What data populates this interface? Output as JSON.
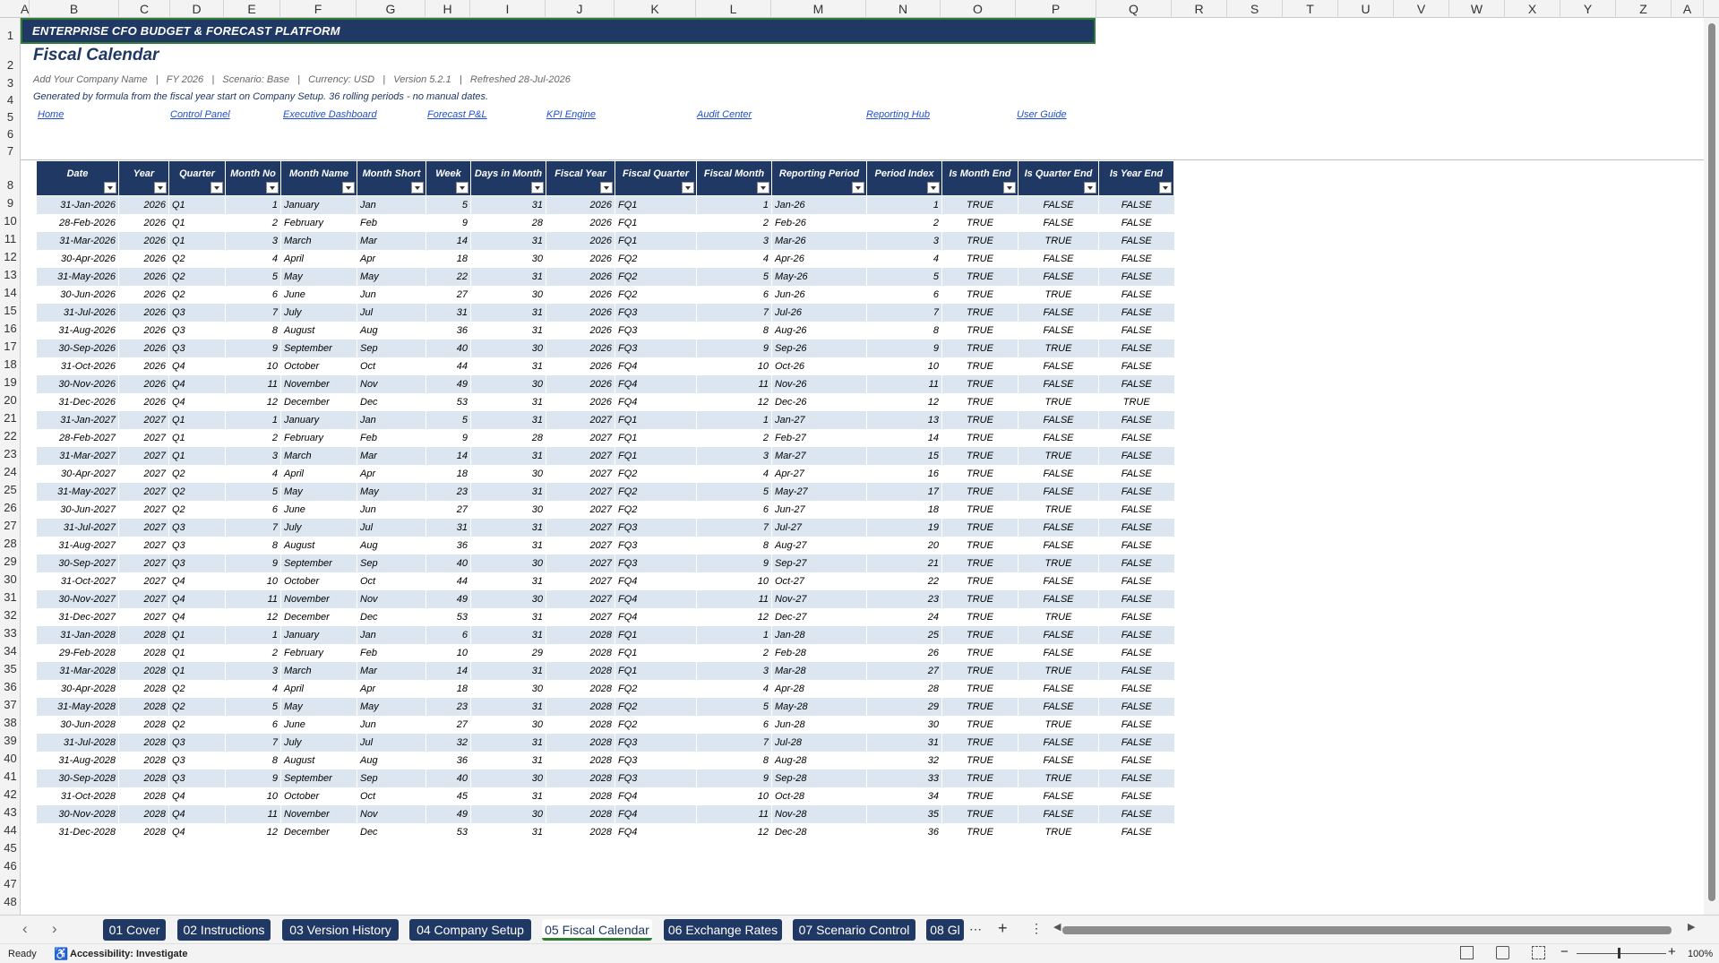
{
  "columns": [
    "A",
    "B",
    "C",
    "D",
    "E",
    "F",
    "G",
    "H",
    "I",
    "J",
    "K",
    "L",
    "M",
    "N",
    "O",
    "P",
    "Q",
    "R",
    "S",
    "T",
    "U",
    "V",
    "W",
    "X",
    "Y",
    "Z",
    "A"
  ],
  "rows": [
    "1",
    "2",
    "3",
    "4",
    "5",
    "6",
    "7",
    "8",
    "9",
    "10",
    "11",
    "12",
    "13",
    "14",
    "15",
    "16",
    "17",
    "18",
    "19",
    "20",
    "21",
    "22",
    "23",
    "24",
    "25",
    "26",
    "27",
    "28",
    "29",
    "30",
    "31",
    "32",
    "33",
    "34",
    "35",
    "36",
    "37",
    "38",
    "39",
    "40",
    "41",
    "42",
    "43",
    "44",
    "45",
    "46",
    "47",
    "48"
  ],
  "banner": "ENTERPRISE CFO BUDGET & FORECAST PLATFORM",
  "title": "Fiscal Calendar",
  "meta": "Add Your Company Name   |   FY 2026   |   Scenario: Base   |   Currency: USD   |   Version 5.2.1   |   Refreshed 28-Jul-2026",
  "note": "Generated by formula from the fiscal year start on Company Setup. 36 rolling periods - no manual dates.",
  "links": [
    "Home",
    "Control Panel",
    "Executive Dashboard",
    "Forecast P&L",
    "KPI Engine",
    "Audit Center",
    "Reporting Hub",
    "User Guide"
  ],
  "table": {
    "headers": [
      "Date",
      "Year",
      "Quarter",
      "Month No",
      "Month Name",
      "Month Short",
      "Week",
      "Days in Month",
      "Fiscal Year",
      "Fiscal Quarter",
      "Fiscal Month",
      "Reporting Period",
      "Period Index",
      "Is Month End",
      "Is Quarter End",
      "Is Year End"
    ],
    "rows": [
      [
        "31-Jan-2026",
        "2026",
        "Q1",
        "1",
        "January",
        "Jan",
        "5",
        "31",
        "2026",
        "FQ1",
        "1",
        "Jan-26",
        "1",
        "TRUE",
        "FALSE",
        "FALSE"
      ],
      [
        "28-Feb-2026",
        "2026",
        "Q1",
        "2",
        "February",
        "Feb",
        "9",
        "28",
        "2026",
        "FQ1",
        "2",
        "Feb-26",
        "2",
        "TRUE",
        "FALSE",
        "FALSE"
      ],
      [
        "31-Mar-2026",
        "2026",
        "Q1",
        "3",
        "March",
        "Mar",
        "14",
        "31",
        "2026",
        "FQ1",
        "3",
        "Mar-26",
        "3",
        "TRUE",
        "TRUE",
        "FALSE"
      ],
      [
        "30-Apr-2026",
        "2026",
        "Q2",
        "4",
        "April",
        "Apr",
        "18",
        "30",
        "2026",
        "FQ2",
        "4",
        "Apr-26",
        "4",
        "TRUE",
        "FALSE",
        "FALSE"
      ],
      [
        "31-May-2026",
        "2026",
        "Q2",
        "5",
        "May",
        "May",
        "22",
        "31",
        "2026",
        "FQ2",
        "5",
        "May-26",
        "5",
        "TRUE",
        "FALSE",
        "FALSE"
      ],
      [
        "30-Jun-2026",
        "2026",
        "Q2",
        "6",
        "June",
        "Jun",
        "27",
        "30",
        "2026",
        "FQ2",
        "6",
        "Jun-26",
        "6",
        "TRUE",
        "TRUE",
        "FALSE"
      ],
      [
        "31-Jul-2026",
        "2026",
        "Q3",
        "7",
        "July",
        "Jul",
        "31",
        "31",
        "2026",
        "FQ3",
        "7",
        "Jul-26",
        "7",
        "TRUE",
        "FALSE",
        "FALSE"
      ],
      [
        "31-Aug-2026",
        "2026",
        "Q3",
        "8",
        "August",
        "Aug",
        "36",
        "31",
        "2026",
        "FQ3",
        "8",
        "Aug-26",
        "8",
        "TRUE",
        "FALSE",
        "FALSE"
      ],
      [
        "30-Sep-2026",
        "2026",
        "Q3",
        "9",
        "September",
        "Sep",
        "40",
        "30",
        "2026",
        "FQ3",
        "9",
        "Sep-26",
        "9",
        "TRUE",
        "TRUE",
        "FALSE"
      ],
      [
        "31-Oct-2026",
        "2026",
        "Q4",
        "10",
        "October",
        "Oct",
        "44",
        "31",
        "2026",
        "FQ4",
        "10",
        "Oct-26",
        "10",
        "TRUE",
        "FALSE",
        "FALSE"
      ],
      [
        "30-Nov-2026",
        "2026",
        "Q4",
        "11",
        "November",
        "Nov",
        "49",
        "30",
        "2026",
        "FQ4",
        "11",
        "Nov-26",
        "11",
        "TRUE",
        "FALSE",
        "FALSE"
      ],
      [
        "31-Dec-2026",
        "2026",
        "Q4",
        "12",
        "December",
        "Dec",
        "53",
        "31",
        "2026",
        "FQ4",
        "12",
        "Dec-26",
        "12",
        "TRUE",
        "TRUE",
        "TRUE"
      ],
      [
        "31-Jan-2027",
        "2027",
        "Q1",
        "1",
        "January",
        "Jan",
        "5",
        "31",
        "2027",
        "FQ1",
        "1",
        "Jan-27",
        "13",
        "TRUE",
        "FALSE",
        "FALSE"
      ],
      [
        "28-Feb-2027",
        "2027",
        "Q1",
        "2",
        "February",
        "Feb",
        "9",
        "28",
        "2027",
        "FQ1",
        "2",
        "Feb-27",
        "14",
        "TRUE",
        "FALSE",
        "FALSE"
      ],
      [
        "31-Mar-2027",
        "2027",
        "Q1",
        "3",
        "March",
        "Mar",
        "14",
        "31",
        "2027",
        "FQ1",
        "3",
        "Mar-27",
        "15",
        "TRUE",
        "TRUE",
        "FALSE"
      ],
      [
        "30-Apr-2027",
        "2027",
        "Q2",
        "4",
        "April",
        "Apr",
        "18",
        "30",
        "2027",
        "FQ2",
        "4",
        "Apr-27",
        "16",
        "TRUE",
        "FALSE",
        "FALSE"
      ],
      [
        "31-May-2027",
        "2027",
        "Q2",
        "5",
        "May",
        "May",
        "23",
        "31",
        "2027",
        "FQ2",
        "5",
        "May-27",
        "17",
        "TRUE",
        "FALSE",
        "FALSE"
      ],
      [
        "30-Jun-2027",
        "2027",
        "Q2",
        "6",
        "June",
        "Jun",
        "27",
        "30",
        "2027",
        "FQ2",
        "6",
        "Jun-27",
        "18",
        "TRUE",
        "TRUE",
        "FALSE"
      ],
      [
        "31-Jul-2027",
        "2027",
        "Q3",
        "7",
        "July",
        "Jul",
        "31",
        "31",
        "2027",
        "FQ3",
        "7",
        "Jul-27",
        "19",
        "TRUE",
        "FALSE",
        "FALSE"
      ],
      [
        "31-Aug-2027",
        "2027",
        "Q3",
        "8",
        "August",
        "Aug",
        "36",
        "31",
        "2027",
        "FQ3",
        "8",
        "Aug-27",
        "20",
        "TRUE",
        "FALSE",
        "FALSE"
      ],
      [
        "30-Sep-2027",
        "2027",
        "Q3",
        "9",
        "September",
        "Sep",
        "40",
        "30",
        "2027",
        "FQ3",
        "9",
        "Sep-27",
        "21",
        "TRUE",
        "TRUE",
        "FALSE"
      ],
      [
        "31-Oct-2027",
        "2027",
        "Q4",
        "10",
        "October",
        "Oct",
        "44",
        "31",
        "2027",
        "FQ4",
        "10",
        "Oct-27",
        "22",
        "TRUE",
        "FALSE",
        "FALSE"
      ],
      [
        "30-Nov-2027",
        "2027",
        "Q4",
        "11",
        "November",
        "Nov",
        "49",
        "30",
        "2027",
        "FQ4",
        "11",
        "Nov-27",
        "23",
        "TRUE",
        "FALSE",
        "FALSE"
      ],
      [
        "31-Dec-2027",
        "2027",
        "Q4",
        "12",
        "December",
        "Dec",
        "53",
        "31",
        "2027",
        "FQ4",
        "12",
        "Dec-27",
        "24",
        "TRUE",
        "TRUE",
        "FALSE"
      ],
      [
        "31-Jan-2028",
        "2028",
        "Q1",
        "1",
        "January",
        "Jan",
        "6",
        "31",
        "2028",
        "FQ1",
        "1",
        "Jan-28",
        "25",
        "TRUE",
        "FALSE",
        "FALSE"
      ],
      [
        "29-Feb-2028",
        "2028",
        "Q1",
        "2",
        "February",
        "Feb",
        "10",
        "29",
        "2028",
        "FQ1",
        "2",
        "Feb-28",
        "26",
        "TRUE",
        "FALSE",
        "FALSE"
      ],
      [
        "31-Mar-2028",
        "2028",
        "Q1",
        "3",
        "March",
        "Mar",
        "14",
        "31",
        "2028",
        "FQ1",
        "3",
        "Mar-28",
        "27",
        "TRUE",
        "TRUE",
        "FALSE"
      ],
      [
        "30-Apr-2028",
        "2028",
        "Q2",
        "4",
        "April",
        "Apr",
        "18",
        "30",
        "2028",
        "FQ2",
        "4",
        "Apr-28",
        "28",
        "TRUE",
        "FALSE",
        "FALSE"
      ],
      [
        "31-May-2028",
        "2028",
        "Q2",
        "5",
        "May",
        "May",
        "23",
        "31",
        "2028",
        "FQ2",
        "5",
        "May-28",
        "29",
        "TRUE",
        "FALSE",
        "FALSE"
      ],
      [
        "30-Jun-2028",
        "2028",
        "Q2",
        "6",
        "June",
        "Jun",
        "27",
        "30",
        "2028",
        "FQ2",
        "6",
        "Jun-28",
        "30",
        "TRUE",
        "TRUE",
        "FALSE"
      ],
      [
        "31-Jul-2028",
        "2028",
        "Q3",
        "7",
        "July",
        "Jul",
        "32",
        "31",
        "2028",
        "FQ3",
        "7",
        "Jul-28",
        "31",
        "TRUE",
        "FALSE",
        "FALSE"
      ],
      [
        "31-Aug-2028",
        "2028",
        "Q3",
        "8",
        "August",
        "Aug",
        "36",
        "31",
        "2028",
        "FQ3",
        "8",
        "Aug-28",
        "32",
        "TRUE",
        "FALSE",
        "FALSE"
      ],
      [
        "30-Sep-2028",
        "2028",
        "Q3",
        "9",
        "September",
        "Sep",
        "40",
        "30",
        "2028",
        "FQ3",
        "9",
        "Sep-28",
        "33",
        "TRUE",
        "TRUE",
        "FALSE"
      ],
      [
        "31-Oct-2028",
        "2028",
        "Q4",
        "10",
        "October",
        "Oct",
        "45",
        "31",
        "2028",
        "FQ4",
        "10",
        "Oct-28",
        "34",
        "TRUE",
        "FALSE",
        "FALSE"
      ],
      [
        "30-Nov-2028",
        "2028",
        "Q4",
        "11",
        "November",
        "Nov",
        "49",
        "30",
        "2028",
        "FQ4",
        "11",
        "Nov-28",
        "35",
        "TRUE",
        "FALSE",
        "FALSE"
      ],
      [
        "31-Dec-2028",
        "2028",
        "Q4",
        "12",
        "December",
        "Dec",
        "53",
        "31",
        "2028",
        "FQ4",
        "12",
        "Dec-28",
        "36",
        "TRUE",
        "TRUE",
        "FALSE"
      ]
    ]
  },
  "tabs": [
    {
      "label": "01 Cover"
    },
    {
      "label": "02 Instructions"
    },
    {
      "label": "03 Version History"
    },
    {
      "label": "04 Company Setup"
    },
    {
      "label": "05 Fiscal Calendar",
      "active": true
    },
    {
      "label": "06 Exchange Rates"
    },
    {
      "label": "07 Scenario Control"
    },
    {
      "label": "08 Gl"
    }
  ],
  "status": {
    "ready": "Ready",
    "accessibility": "Accessibility: Investigate",
    "zoom": "100%"
  },
  "colors": {
    "header_navy": "#1f3864",
    "band": "#dce6f1",
    "link": "#1f4fd6",
    "selection": "#2e7d32"
  },
  "icons": [
    "filter-dropdown-icon",
    "more-tabs-icon",
    "add-sheet-icon",
    "options-icon",
    "normal-view-icon",
    "page-layout-icon",
    "page-break-icon",
    "zoom-out-icon",
    "zoom-in-icon",
    "accessibility-icon"
  ]
}
